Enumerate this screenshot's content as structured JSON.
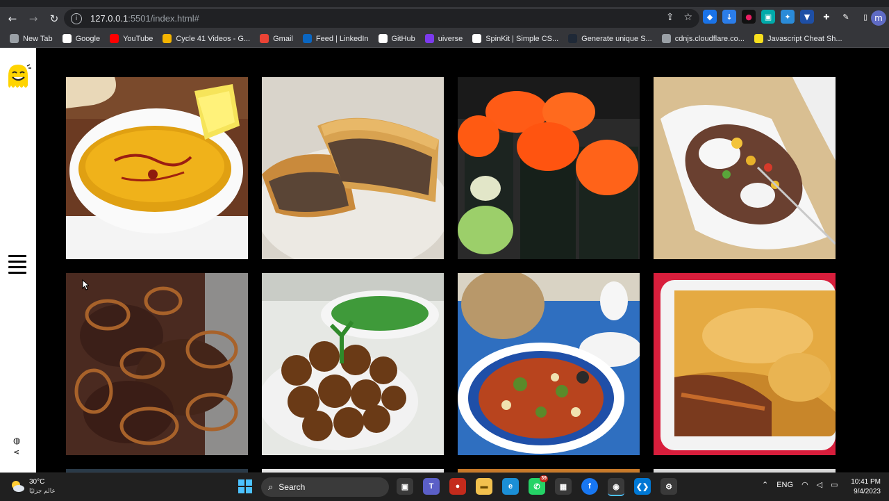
{
  "browser": {
    "url_host": "127.0.0.1",
    "url_rest": ":5501/index.html#",
    "profile_initial": "m",
    "bookmarks": [
      {
        "label": "New Tab",
        "icon": "globe-icon",
        "color": "#9aa0a6"
      },
      {
        "label": "Google",
        "icon": "google-icon",
        "color": "#ffffff"
      },
      {
        "label": "YouTube",
        "icon": "youtube-icon",
        "color": "#ff0000"
      },
      {
        "label": "Cycle 41 Videos - G...",
        "icon": "drive-icon",
        "color": "#f4b400"
      },
      {
        "label": "Gmail",
        "icon": "gmail-icon",
        "color": "#ea4335"
      },
      {
        "label": "Feed | LinkedIn",
        "icon": "linkedin-icon",
        "color": "#0a66c2"
      },
      {
        "label": "GitHub",
        "icon": "github-icon",
        "color": "#ffffff"
      },
      {
        "label": "uiverse",
        "icon": "uiverse-icon",
        "color": "#7c3aed"
      },
      {
        "label": "SpinKit | Simple CS...",
        "icon": "spinkit-icon",
        "color": "#ffffff"
      },
      {
        "label": "Generate unique S...",
        "icon": "dot-icon",
        "color": "#1f2937"
      },
      {
        "label": "cdnjs.cloudflare.co...",
        "icon": "globe-icon",
        "color": "#9aa0a6"
      },
      {
        "label": "Javascript Cheat Sh...",
        "icon": "js-icon",
        "color": "#f7df1e"
      }
    ]
  },
  "taskbar": {
    "weather_temp": "30°C",
    "weather_desc": "عالم جزئيًا",
    "search_label": "Search",
    "lang": "ENG",
    "time": "10:41 PM",
    "date": "9/4/2023"
  }
}
